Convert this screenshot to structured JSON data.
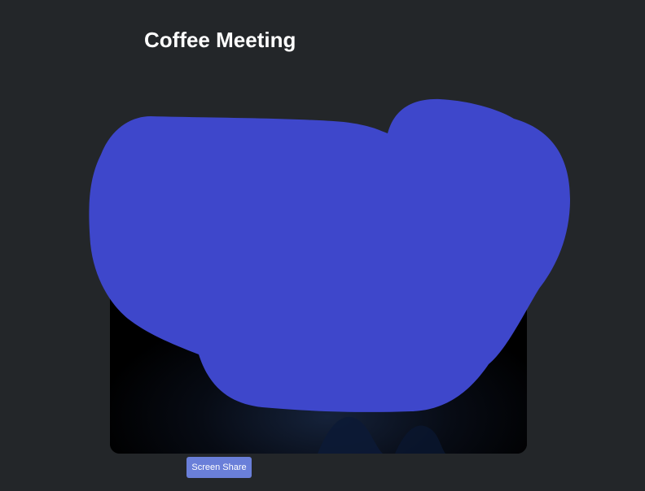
{
  "page": {
    "title": "Coffee Meeting"
  },
  "controls": {
    "screen_share_label": "Screen Share"
  },
  "colors": {
    "background": "#232629",
    "video_background": "#000000",
    "redaction": "#3e47cb",
    "button": "#6a7fd9"
  }
}
